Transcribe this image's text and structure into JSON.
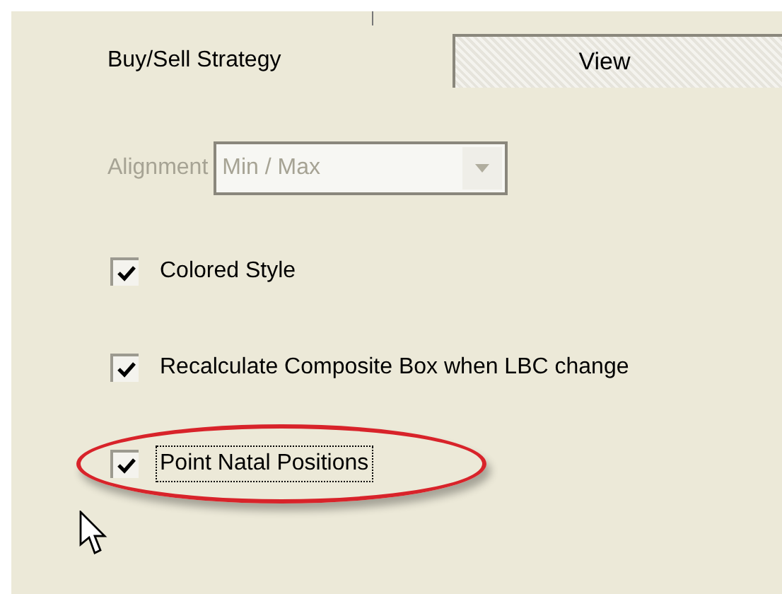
{
  "strategy": {
    "label": "Buy/Sell Strategy",
    "button": "View"
  },
  "alignment": {
    "label": "Alignment",
    "value": "Min / Max",
    "disabled": true
  },
  "options": [
    {
      "label": "Colored Style",
      "checked": true,
      "focused": false,
      "highlighted": false
    },
    {
      "label": "Recalculate Composite Box when LBC change",
      "checked": true,
      "focused": false,
      "highlighted": false
    },
    {
      "label": "Point Natal Positions",
      "checked": true,
      "focused": true,
      "highlighted": true
    }
  ]
}
